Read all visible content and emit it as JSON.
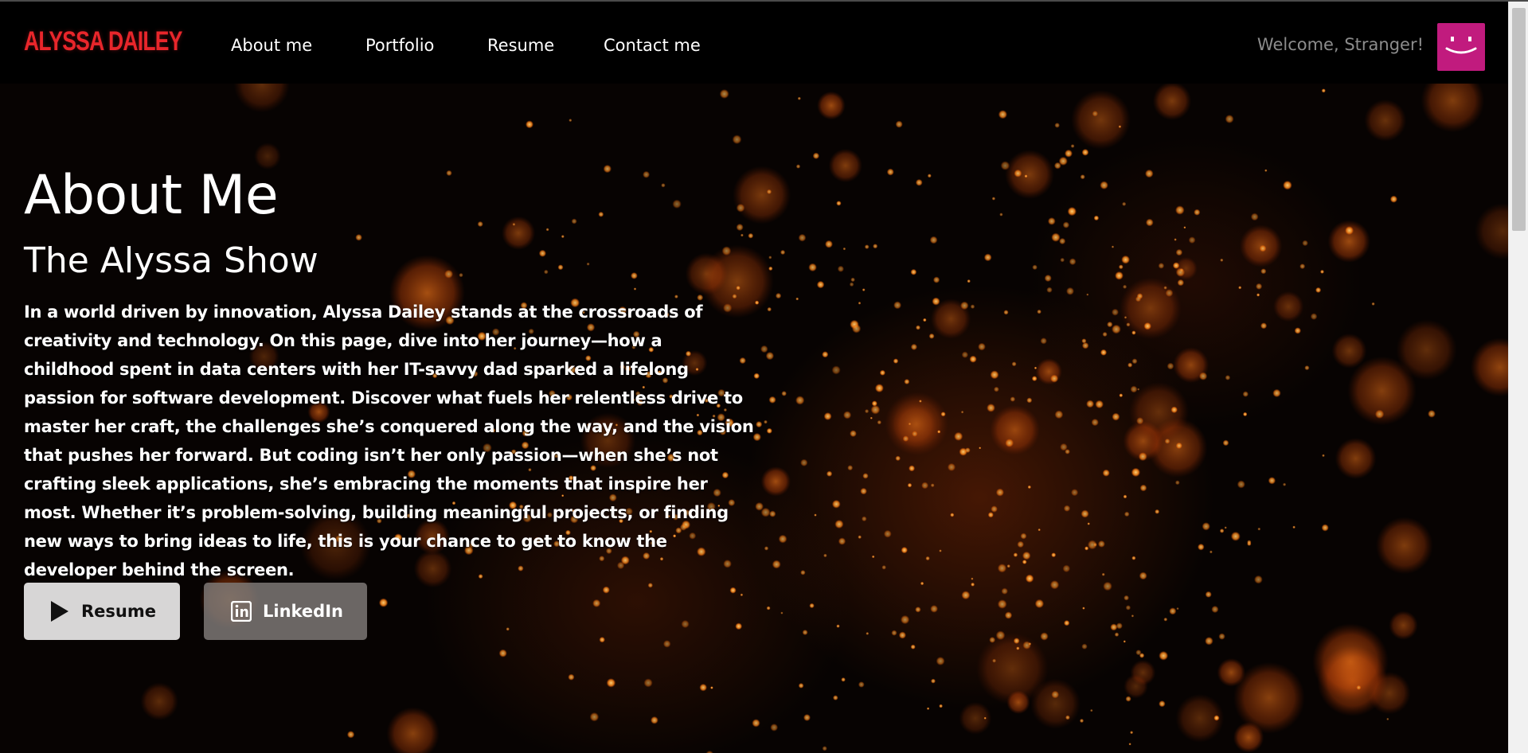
{
  "navbar": {
    "brand": "ALYSSA DAILEY",
    "links": [
      {
        "label": "About me"
      },
      {
        "label": "Portfolio"
      },
      {
        "label": "Resume"
      },
      {
        "label": "Contact me"
      }
    ],
    "welcome": "Welcome, Stranger!",
    "avatar_icon": "smiley-face-icon"
  },
  "hero": {
    "title": "About Me",
    "subtitle": "The Alyssa Show",
    "bio": "In a world driven by innovation, Alyssa Dailey stands at the crossroads of creativity and technology. On this page, dive into her journey—how a childhood spent in data centers with her IT-savvy dad sparked a lifelong passion for software development. Discover what fuels her relentless drive to master her craft, the challenges she’s conquered along the way, and the vision that pushes her forward. But coding isn’t her only passion—when she’s not crafting sleek applications, she’s embracing the moments that inspire her most. Whether it’s problem-solving, building meaningful projects, or finding new ways to bring ideas to life, this is your chance to get to know the developer behind the screen.",
    "buttons": {
      "resume": {
        "label": "Resume",
        "icon": "play-icon"
      },
      "linkedin": {
        "label": "LinkedIn",
        "icon": "linkedin-icon"
      }
    }
  },
  "colors": {
    "brand": "#e8262b",
    "avatar": "#c11b7e",
    "welcome_text": "#8c8c8c",
    "bokeh": "#ff6a00"
  }
}
